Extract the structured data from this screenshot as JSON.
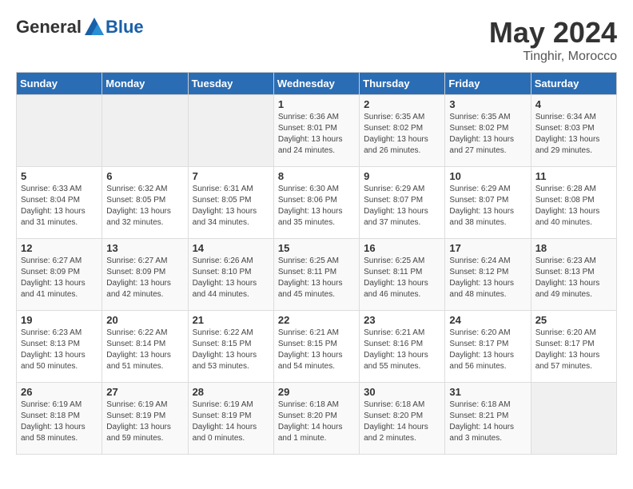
{
  "header": {
    "logo_general": "General",
    "logo_blue": "Blue",
    "month_year": "May 2024",
    "location": "Tinghir, Morocco"
  },
  "days_of_week": [
    "Sunday",
    "Monday",
    "Tuesday",
    "Wednesday",
    "Thursday",
    "Friday",
    "Saturday"
  ],
  "weeks": [
    [
      {
        "day": "",
        "info": ""
      },
      {
        "day": "",
        "info": ""
      },
      {
        "day": "",
        "info": ""
      },
      {
        "day": "1",
        "info": "Sunrise: 6:36 AM\nSunset: 8:01 PM\nDaylight: 13 hours\nand 24 minutes."
      },
      {
        "day": "2",
        "info": "Sunrise: 6:35 AM\nSunset: 8:02 PM\nDaylight: 13 hours\nand 26 minutes."
      },
      {
        "day": "3",
        "info": "Sunrise: 6:35 AM\nSunset: 8:02 PM\nDaylight: 13 hours\nand 27 minutes."
      },
      {
        "day": "4",
        "info": "Sunrise: 6:34 AM\nSunset: 8:03 PM\nDaylight: 13 hours\nand 29 minutes."
      }
    ],
    [
      {
        "day": "5",
        "info": "Sunrise: 6:33 AM\nSunset: 8:04 PM\nDaylight: 13 hours\nand 31 minutes."
      },
      {
        "day": "6",
        "info": "Sunrise: 6:32 AM\nSunset: 8:05 PM\nDaylight: 13 hours\nand 32 minutes."
      },
      {
        "day": "7",
        "info": "Sunrise: 6:31 AM\nSunset: 8:05 PM\nDaylight: 13 hours\nand 34 minutes."
      },
      {
        "day": "8",
        "info": "Sunrise: 6:30 AM\nSunset: 8:06 PM\nDaylight: 13 hours\nand 35 minutes."
      },
      {
        "day": "9",
        "info": "Sunrise: 6:29 AM\nSunset: 8:07 PM\nDaylight: 13 hours\nand 37 minutes."
      },
      {
        "day": "10",
        "info": "Sunrise: 6:29 AM\nSunset: 8:07 PM\nDaylight: 13 hours\nand 38 minutes."
      },
      {
        "day": "11",
        "info": "Sunrise: 6:28 AM\nSunset: 8:08 PM\nDaylight: 13 hours\nand 40 minutes."
      }
    ],
    [
      {
        "day": "12",
        "info": "Sunrise: 6:27 AM\nSunset: 8:09 PM\nDaylight: 13 hours\nand 41 minutes."
      },
      {
        "day": "13",
        "info": "Sunrise: 6:27 AM\nSunset: 8:09 PM\nDaylight: 13 hours\nand 42 minutes."
      },
      {
        "day": "14",
        "info": "Sunrise: 6:26 AM\nSunset: 8:10 PM\nDaylight: 13 hours\nand 44 minutes."
      },
      {
        "day": "15",
        "info": "Sunrise: 6:25 AM\nSunset: 8:11 PM\nDaylight: 13 hours\nand 45 minutes."
      },
      {
        "day": "16",
        "info": "Sunrise: 6:25 AM\nSunset: 8:11 PM\nDaylight: 13 hours\nand 46 minutes."
      },
      {
        "day": "17",
        "info": "Sunrise: 6:24 AM\nSunset: 8:12 PM\nDaylight: 13 hours\nand 48 minutes."
      },
      {
        "day": "18",
        "info": "Sunrise: 6:23 AM\nSunset: 8:13 PM\nDaylight: 13 hours\nand 49 minutes."
      }
    ],
    [
      {
        "day": "19",
        "info": "Sunrise: 6:23 AM\nSunset: 8:13 PM\nDaylight: 13 hours\nand 50 minutes."
      },
      {
        "day": "20",
        "info": "Sunrise: 6:22 AM\nSunset: 8:14 PM\nDaylight: 13 hours\nand 51 minutes."
      },
      {
        "day": "21",
        "info": "Sunrise: 6:22 AM\nSunset: 8:15 PM\nDaylight: 13 hours\nand 53 minutes."
      },
      {
        "day": "22",
        "info": "Sunrise: 6:21 AM\nSunset: 8:15 PM\nDaylight: 13 hours\nand 54 minutes."
      },
      {
        "day": "23",
        "info": "Sunrise: 6:21 AM\nSunset: 8:16 PM\nDaylight: 13 hours\nand 55 minutes."
      },
      {
        "day": "24",
        "info": "Sunrise: 6:20 AM\nSunset: 8:17 PM\nDaylight: 13 hours\nand 56 minutes."
      },
      {
        "day": "25",
        "info": "Sunrise: 6:20 AM\nSunset: 8:17 PM\nDaylight: 13 hours\nand 57 minutes."
      }
    ],
    [
      {
        "day": "26",
        "info": "Sunrise: 6:19 AM\nSunset: 8:18 PM\nDaylight: 13 hours\nand 58 minutes."
      },
      {
        "day": "27",
        "info": "Sunrise: 6:19 AM\nSunset: 8:19 PM\nDaylight: 13 hours\nand 59 minutes."
      },
      {
        "day": "28",
        "info": "Sunrise: 6:19 AM\nSunset: 8:19 PM\nDaylight: 14 hours\nand 0 minutes."
      },
      {
        "day": "29",
        "info": "Sunrise: 6:18 AM\nSunset: 8:20 PM\nDaylight: 14 hours\nand 1 minute."
      },
      {
        "day": "30",
        "info": "Sunrise: 6:18 AM\nSunset: 8:20 PM\nDaylight: 14 hours\nand 2 minutes."
      },
      {
        "day": "31",
        "info": "Sunrise: 6:18 AM\nSunset: 8:21 PM\nDaylight: 14 hours\nand 3 minutes."
      },
      {
        "day": "",
        "info": ""
      }
    ]
  ]
}
